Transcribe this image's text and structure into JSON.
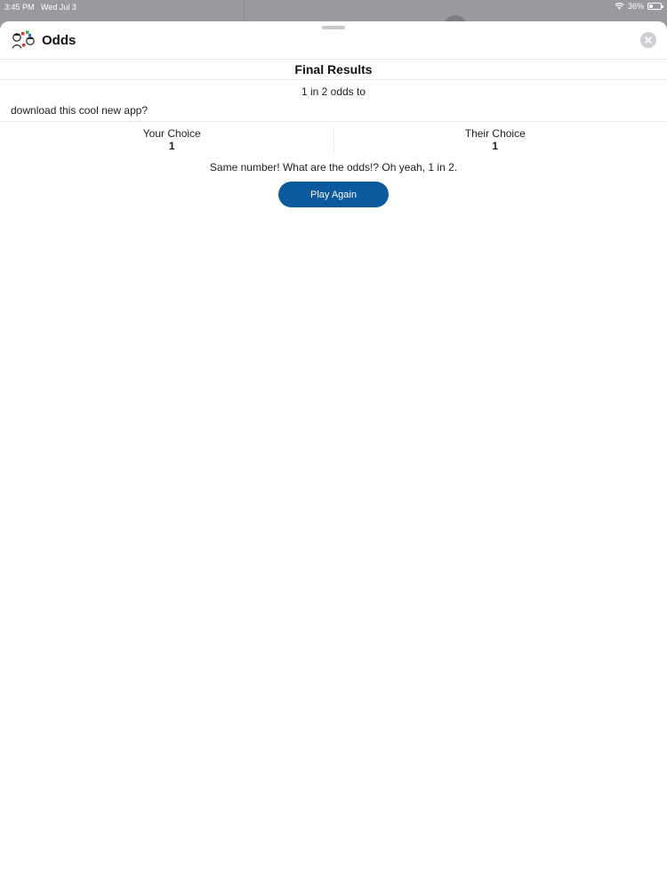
{
  "status_bar": {
    "time": "3:45 PM",
    "date": "Wed Jul 3",
    "battery": "36%",
    "battery_level": 0.36,
    "icons": [
      "wifi-icon",
      "battery-icon"
    ]
  },
  "header": {
    "title": "Odds",
    "logo_icon": "odds-logo-icon",
    "close_icon": "close-icon"
  },
  "results": {
    "title": "Final Results",
    "odds_line_1": "1 in 2 odds to",
    "odds_line_2": "download this cool new app?",
    "your_choice_label": "Your Choice",
    "your_choice_value": "1",
    "their_choice_label": "Their Choice",
    "their_choice_value": "1",
    "message": "Same number! What are the odds!? Oh yeah, 1 in 2.",
    "play_again_label": "Play Again"
  },
  "colors": {
    "accent": "#0b5a9e",
    "backdrop": "#9a9a9e",
    "sheet": "#ffffff",
    "divider": "#ececee"
  }
}
